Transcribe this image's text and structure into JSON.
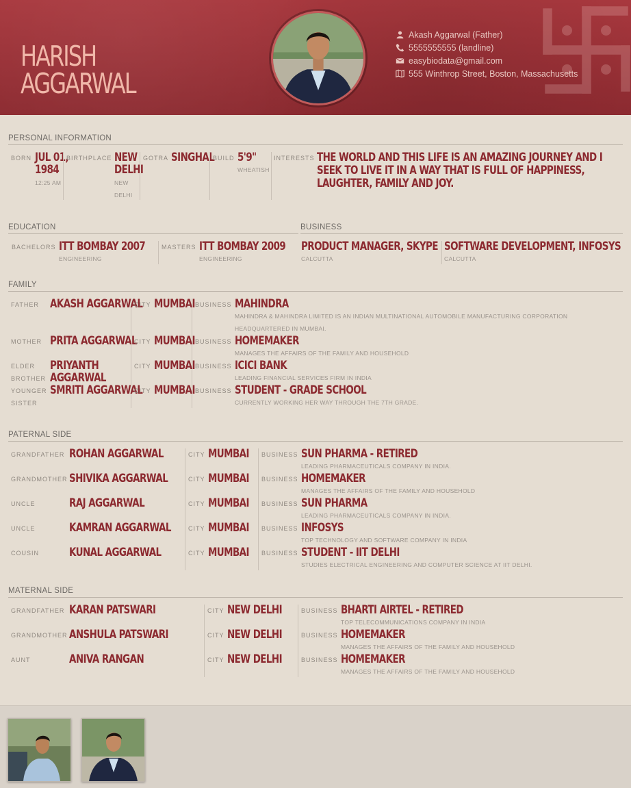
{
  "header": {
    "name_line1": "HARISH",
    "name_line2": "AGGARWAL",
    "contact": {
      "guardian": "Akash Aggarwal (Father)",
      "phone": "5555555555 (landline)",
      "email": "easybiodata@gmail.com",
      "address": "555 Winthrop Street, Boston, Massachusetts"
    },
    "icons": [
      "user-icon",
      "phone-icon",
      "mail-icon",
      "map-icon",
      "swastika-icon"
    ]
  },
  "personal": {
    "title": "PERSONAL INFORMATION",
    "born_label": "BORN",
    "born_value_l1": "JUL 01,",
    "born_value_l2": "1984",
    "born_sub": "12:25 AM",
    "birthplace_label": "BIRTHPLACE",
    "birthplace_l1": "NEW",
    "birthplace_l2": "DELHI",
    "birthplace_sub_l1": "NEW",
    "birthplace_sub_l2": "DELHI",
    "gotra_label": "GOTRA",
    "gotra_value": "SINGHAL",
    "build_label": "BUILD",
    "build_value": "5'9\"",
    "build_sub": "WHEATISH",
    "interests_label": "INTERESTS",
    "interests_value": "THE WORLD AND THIS LIFE IS AN AMAZING JOURNEY AND I SEEK TO LIVE IT IN A WAY THAT IS FULL OF HAPPINESS, LAUGHTER, FAMILY AND JOY."
  },
  "education": {
    "title": "EDUCATION",
    "items": [
      {
        "label": "BACHELORS",
        "value": "ITT BOMBAY 2007",
        "sub": "ENGINEERING"
      },
      {
        "label": "MASTERS",
        "value": "ITT BOMBAY 2009",
        "sub": "ENGINEERING"
      }
    ]
  },
  "business": {
    "title": "BUSINESS",
    "items": [
      {
        "value": "PRODUCT MANAGER, SKYPE",
        "sub": "CALCUTTA"
      },
      {
        "value": "SOFTWARE DEVELOPMENT, INFOSYS",
        "sub": "CALCUTTA"
      }
    ]
  },
  "family": {
    "title": "FAMILY",
    "city_label": "CITY",
    "business_label": "BUSINESS",
    "rows": [
      {
        "relation_l1": "FATHER",
        "relation_l2": "",
        "name_l1": "AKASH AGGARWAL",
        "name_l2": "",
        "city": "MUMBAI",
        "business": "MAHINDRA",
        "desc_l1": "MAHINDRA & MAHINDRA LIMITED IS AN INDIAN MULTINATIONAL AUTOMOBILE MANUFACTURING CORPORATION",
        "desc_l2": "HEADQUARTERED IN MUMBAI."
      },
      {
        "relation_l1": "MOTHER",
        "relation_l2": "",
        "name_l1": "PRITA AGGARWAL",
        "name_l2": "",
        "city": "MUMBAI",
        "business": "HOMEMAKER",
        "desc_l1": "MANAGES THE AFFAIRS OF THE FAMILY AND HOUSEHOLD",
        "desc_l2": ""
      },
      {
        "relation_l1": "ELDER",
        "relation_l2": "BROTHER",
        "name_l1": "PRIYANTH",
        "name_l2": "AGGARWAL",
        "city": "MUMBAI",
        "business": "ICICI BANK",
        "desc_l1": "LEADING FINANCIAL SERVICES FIRM IN INDIA",
        "desc_l2": ""
      },
      {
        "relation_l1": "YOUNGER",
        "relation_l2": "SISTER",
        "name_l1": "SMRITI AGGARWAL",
        "name_l2": "",
        "city": "MUMBAI",
        "business": "STUDENT - GRADE SCHOOL",
        "desc_l1": "CURRENTLY WORKING HER WAY THROUGH THE 7TH GRADE.",
        "desc_l2": ""
      }
    ]
  },
  "paternal": {
    "title": "PATERNAL SIDE",
    "city_label": "CITY",
    "business_label": "BUSINESS",
    "rows": [
      {
        "relation": "GRANDFATHER",
        "name": "ROHAN AGGARWAL",
        "city": "MUMBAI",
        "business": "SUN PHARMA - RETIRED",
        "desc": "LEADING PHARMACEUTICALS COMPANY IN INDIA."
      },
      {
        "relation": "GRANDMOTHER",
        "name": "SHIVIKA AGGARWAL",
        "city": "MUMBAI",
        "business": "HOMEMAKER",
        "desc": "MANAGES THE AFFAIRS OF THE FAMILY AND HOUSEHOLD"
      },
      {
        "relation": "UNCLE",
        "name": "RAJ AGGARWAL",
        "city": "MUMBAI",
        "business": "SUN PHARMA",
        "desc": "LEADING PHARMACEUTICALS COMPANY IN INDIA."
      },
      {
        "relation": "UNCLE",
        "name": "KAMRAN AGGARWAL",
        "city": "MUMBAI",
        "business": "INFOSYS",
        "desc": "TOP TECHNOLOGY AND SOFTWARE COMPANY IN INDIA"
      },
      {
        "relation": "COUSIN",
        "name": "KUNAL AGGARWAL",
        "city": "MUMBAI",
        "business": "STUDENT - IIT DELHI",
        "desc": "STUDIES ELECTRICAL ENGINEERING AND COMPUTER SCIENCE AT IIT DELHI."
      }
    ]
  },
  "maternal": {
    "title": "MATERNAL SIDE",
    "city_label": "CITY",
    "business_label": "BUSINESS",
    "rows": [
      {
        "relation": "GRANDFATHER",
        "name": "KARAN PATSWARI",
        "city": "NEW DELHI",
        "business": "BHARTI AIRTEL - RETIRED",
        "desc": "TOP TELECOMMUNICATIONS COMPANY IN INDIA"
      },
      {
        "relation": "GRANDMOTHER",
        "name": "ANSHULA PATSWARI",
        "city": "NEW DELHI",
        "business": "HOMEMAKER",
        "desc": "MANAGES THE AFFAIRS OF THE FAMILY AND HOUSEHOLD"
      },
      {
        "relation": "AUNT",
        "name": "ANIVA RANGAN",
        "city": "NEW DELHI",
        "business": "HOMEMAKER",
        "desc": "MANAGES THE AFFAIRS OF THE FAMILY AND HOUSEHOLD"
      }
    ]
  },
  "colors": {
    "header_red": "#9c3238",
    "name_pink": "#f0b7a9",
    "accent_red": "#8c2a30",
    "paper": "#e5ddd2",
    "label_gray": "#8f8880"
  }
}
